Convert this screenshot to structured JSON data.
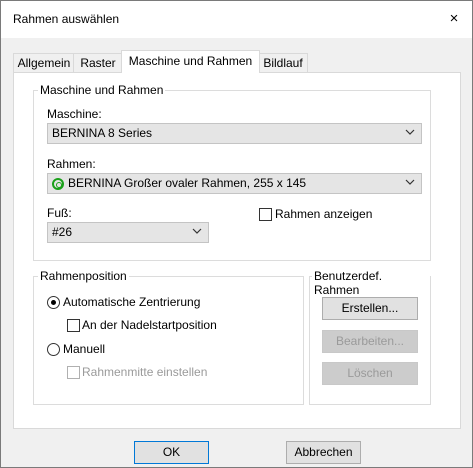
{
  "window": {
    "title": "Rahmen auswählen",
    "close_icon": "×"
  },
  "tabs": [
    {
      "label": "Allgemein"
    },
    {
      "label": "Raster"
    },
    {
      "label": "Maschine und Rahmen",
      "active": true
    },
    {
      "label": "Bildlauf"
    }
  ],
  "machine_group": {
    "legend": "Maschine und Rahmen",
    "machine_label": "Maschine:",
    "machine_value": "BERNINA 8 Series",
    "hoop_label": "Rahmen:",
    "hoop_value": "BERNINA Großer ovaler Rahmen, 255 x 145",
    "hoop_icon_color": "#1aa01a",
    "foot_label": "Fuß:",
    "foot_value": "#26",
    "show_hoop_label": "Rahmen anzeigen",
    "show_hoop_checked": false
  },
  "position_group": {
    "legend": "Rahmenposition",
    "auto_center_label": "Automatische Zentrierung",
    "auto_center_selected": true,
    "needle_start_label": "An der Nadelstartposition",
    "needle_start_checked": false,
    "manual_label": "Manuell",
    "manual_selected": false,
    "set_center_label": "Rahmenmitte einstellen",
    "set_center_enabled": false
  },
  "custom_group": {
    "legend": "Benutzerdef. Rahmen",
    "create_label": "Erstellen...",
    "edit_label": "Bearbeiten...",
    "delete_label": "Löschen"
  },
  "footer": {
    "ok_label": "OK",
    "cancel_label": "Abbrechen"
  }
}
